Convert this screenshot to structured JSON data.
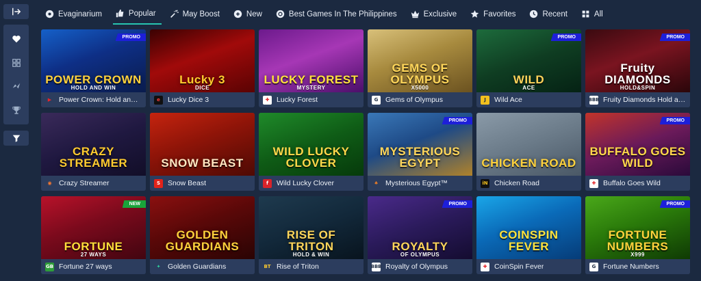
{
  "tabs": [
    {
      "label": "Evaginarium",
      "icon": "gear-icon"
    },
    {
      "label": "Popular",
      "icon": "thumbs-up-icon",
      "active": true
    },
    {
      "label": "May Boost",
      "icon": "fireworks-icon"
    },
    {
      "label": "New",
      "icon": "new-icon"
    },
    {
      "label": "Best Games In The Philippines",
      "icon": "settings-icon"
    },
    {
      "label": "Exclusive",
      "icon": "crown-icon"
    },
    {
      "label": "Favorites",
      "icon": "star-icon"
    },
    {
      "label": "Recent",
      "icon": "clock-icon"
    },
    {
      "label": "All",
      "icon": "grid-icon"
    }
  ],
  "sidebar": {
    "items": [
      {
        "icon": "collapse-arrow-icon"
      },
      {
        "icon": "heart-icon"
      },
      {
        "icon": "grid-small-icon"
      },
      {
        "icon": "lightning-icon"
      },
      {
        "icon": "trophy-icon"
      },
      {
        "icon": "filter-icon"
      }
    ]
  },
  "games": [
    {
      "name": "Power Crown: Hold and Win",
      "art": "POWER CROWN",
      "sub": "HOLD AND WIN",
      "badge": "PROMO",
      "prov": "▶",
      "provColor": "#e8252a",
      "provBg": "transparent",
      "bg": "linear-gradient(160deg,#1560c8 0%,#0e2f86 45%,#0a1c4d 100%)",
      "artColor": "#ffd23c"
    },
    {
      "name": "Lucky Dice 3",
      "art": "Lucky 3",
      "sub": "DICE",
      "badge": "",
      "prov": "e",
      "provColor": "#ff3a3a",
      "provBg": "#101010",
      "bg": "linear-gradient(160deg,#3a0202 0%,#a10a0a 45%,#5a0303 100%)",
      "artColor": "#ffcd2e"
    },
    {
      "name": "Lucky Forest",
      "art": "LUCKY FOREST",
      "sub": "MYSTERY",
      "badge": "",
      "prov": "✚",
      "provColor": "#e31e24",
      "provBg": "#ffffff",
      "bg": "linear-gradient(160deg,#6c1a8c 0%,#a637b5 45%,#4b0f6a 100%)",
      "artColor": "#ffe23c"
    },
    {
      "name": "Gems of Olympus",
      "art": "GEMS OF OLYMPUS",
      "sub": "X5000",
      "badge": "",
      "prov": "G",
      "provColor": "#1b2940",
      "provBg": "#ffffff",
      "bg": "linear-gradient(160deg,#d8c07a 0%,#a78a3e 45%,#6b5220 100%)",
      "artColor": "#ffd65a"
    },
    {
      "name": "Wild Ace",
      "art": "WILD",
      "sub": "ACE",
      "badge": "PROMO",
      "prov": "J",
      "provColor": "#1b2940",
      "provBg": "#f2c01e",
      "bg": "linear-gradient(160deg,#1d6b3c 0%,#0f3d22 50%,#052214 100%)",
      "artColor": "#ffd35a"
    },
    {
      "name": "Fruity Diamonds Hold and Win",
      "art": "Fruity DIAMONDS",
      "sub": "HOLD&SPIN",
      "badge": "PROMO",
      "prov": "BBB",
      "provColor": "#1b2940",
      "provBg": "#ffffff",
      "bg": "linear-gradient(160deg,#3a0a10 0%,#7a1420 45%,#2a060a 100%)",
      "artColor": "#ffffff"
    },
    {
      "name": "Crazy Streamer",
      "art": "CRAZY STREAMER",
      "sub": "",
      "badge": "",
      "prov": "◉",
      "provColor": "#ff7a2f",
      "provBg": "transparent",
      "bg": "linear-gradient(160deg,#3a2a5a 0%,#1f1840 50%,#120e28 100%)",
      "artColor": "#ffcb2f"
    },
    {
      "name": "Snow Beast",
      "art": "SNOW BEAST",
      "sub": "",
      "badge": "",
      "prov": "S",
      "provColor": "#ffffff",
      "provBg": "#e2231a",
      "bg": "linear-gradient(160deg,#c5240f 0%,#8e1408 45%,#4e0a04 100%)",
      "artColor": "#ffe7c2"
    },
    {
      "name": "Wild Lucky Clover",
      "art": "WILD LUCKY CLOVER",
      "sub": "",
      "badge": "",
      "prov": "f",
      "provColor": "#ffffff",
      "provBg": "#d8232a",
      "bg": "linear-gradient(160deg,#1f8a2a 0%,#0f5c16 50%,#063a0b 100%)",
      "artColor": "#ffd84a"
    },
    {
      "name": "Mysterious Egypt™",
      "art": "MYSTERIOUS EGYPT",
      "sub": "",
      "badge": "PROMO",
      "prov": "♠",
      "provColor": "#e07a2a",
      "provBg": "transparent",
      "bg": "linear-gradient(160deg,#3a78b8 0%,#1e4a86 45%,#b0822a 100%)",
      "artColor": "#ffd65a"
    },
    {
      "name": "Chicken Road",
      "art": "CHICKEN ROAD",
      "sub": "",
      "badge": "",
      "prov": "iN",
      "provColor": "#f2c01e",
      "provBg": "#101010",
      "bg": "linear-gradient(160deg,#8a9aa8 0%,#6a7a88 50%,#4a5866 100%)",
      "artColor": "#ffd23c"
    },
    {
      "name": "Buffalo Goes Wild",
      "art": "BUFFALO GOES WILD",
      "sub": "",
      "badge": "PROMO",
      "prov": "✚",
      "provColor": "#e31e24",
      "provBg": "#ffffff",
      "bg": "linear-gradient(160deg,#c2342a 0%,#6a1a5a 50%,#2a0a3a 100%)",
      "artColor": "#ffd84a"
    },
    {
      "name": "Fortune 27 ways",
      "art": "FORTUNE",
      "sub": "27 WAYS",
      "badge": "NEW",
      "prov": "GB",
      "provColor": "#ffffff",
      "provBg": "#2e9d3a",
      "bg": "linear-gradient(160deg,#b8122a 0%,#7a0a1c 45%,#420510 100%)",
      "artColor": "#ffdf3a"
    },
    {
      "name": "Golden Guardians",
      "art": "GOLDEN GUARDIANS",
      "sub": "",
      "badge": "",
      "prov": "✦",
      "provColor": "#2fd6a0",
      "provBg": "transparent",
      "bg": "linear-gradient(160deg,#8a1010 0%,#5a0808 45%,#2a0404 100%)",
      "artColor": "#ffd23c"
    },
    {
      "name": "Rise of Triton",
      "art": "RISE OF TRITON",
      "sub": "HOLD & WIN",
      "badge": "",
      "prov": "BT",
      "provColor": "#ffcb2f",
      "provBg": "transparent",
      "bg": "linear-gradient(160deg,#1e3a4e 0%,#12283a 50%,#08141e 100%)",
      "artColor": "#ffd65a"
    },
    {
      "name": "Royalty of Olympus",
      "art": "ROYALTY",
      "sub": "OF OLYMPUS",
      "badge": "PROMO",
      "prov": "BBB",
      "provColor": "#1b2940",
      "provBg": "#ffffff",
      "bg": "linear-gradient(160deg,#4a2a8a 0%,#2a1a5a 50%,#140c30 100%)",
      "artColor": "#ffd65a"
    },
    {
      "name": "CoinSpin Fever",
      "art": "COINSPIN FEVER",
      "sub": "",
      "badge": "",
      "prov": "✚",
      "provColor": "#e31e24",
      "provBg": "#ffffff",
      "bg": "linear-gradient(160deg,#1aa6e8 0%,#0a6ab8 45%,#063c78 100%)",
      "artColor": "#ffe23c"
    },
    {
      "name": "Fortune Numbers",
      "art": "FORTUNE NUMBERS",
      "sub": "X999",
      "badge": "PROMO",
      "prov": "G",
      "provColor": "#1b2940",
      "provBg": "#ffffff",
      "bg": "linear-gradient(160deg,#4aa81a 0%,#2a7a0a 45%,#0f3a04 100%)",
      "artColor": "#ffd23c"
    }
  ]
}
